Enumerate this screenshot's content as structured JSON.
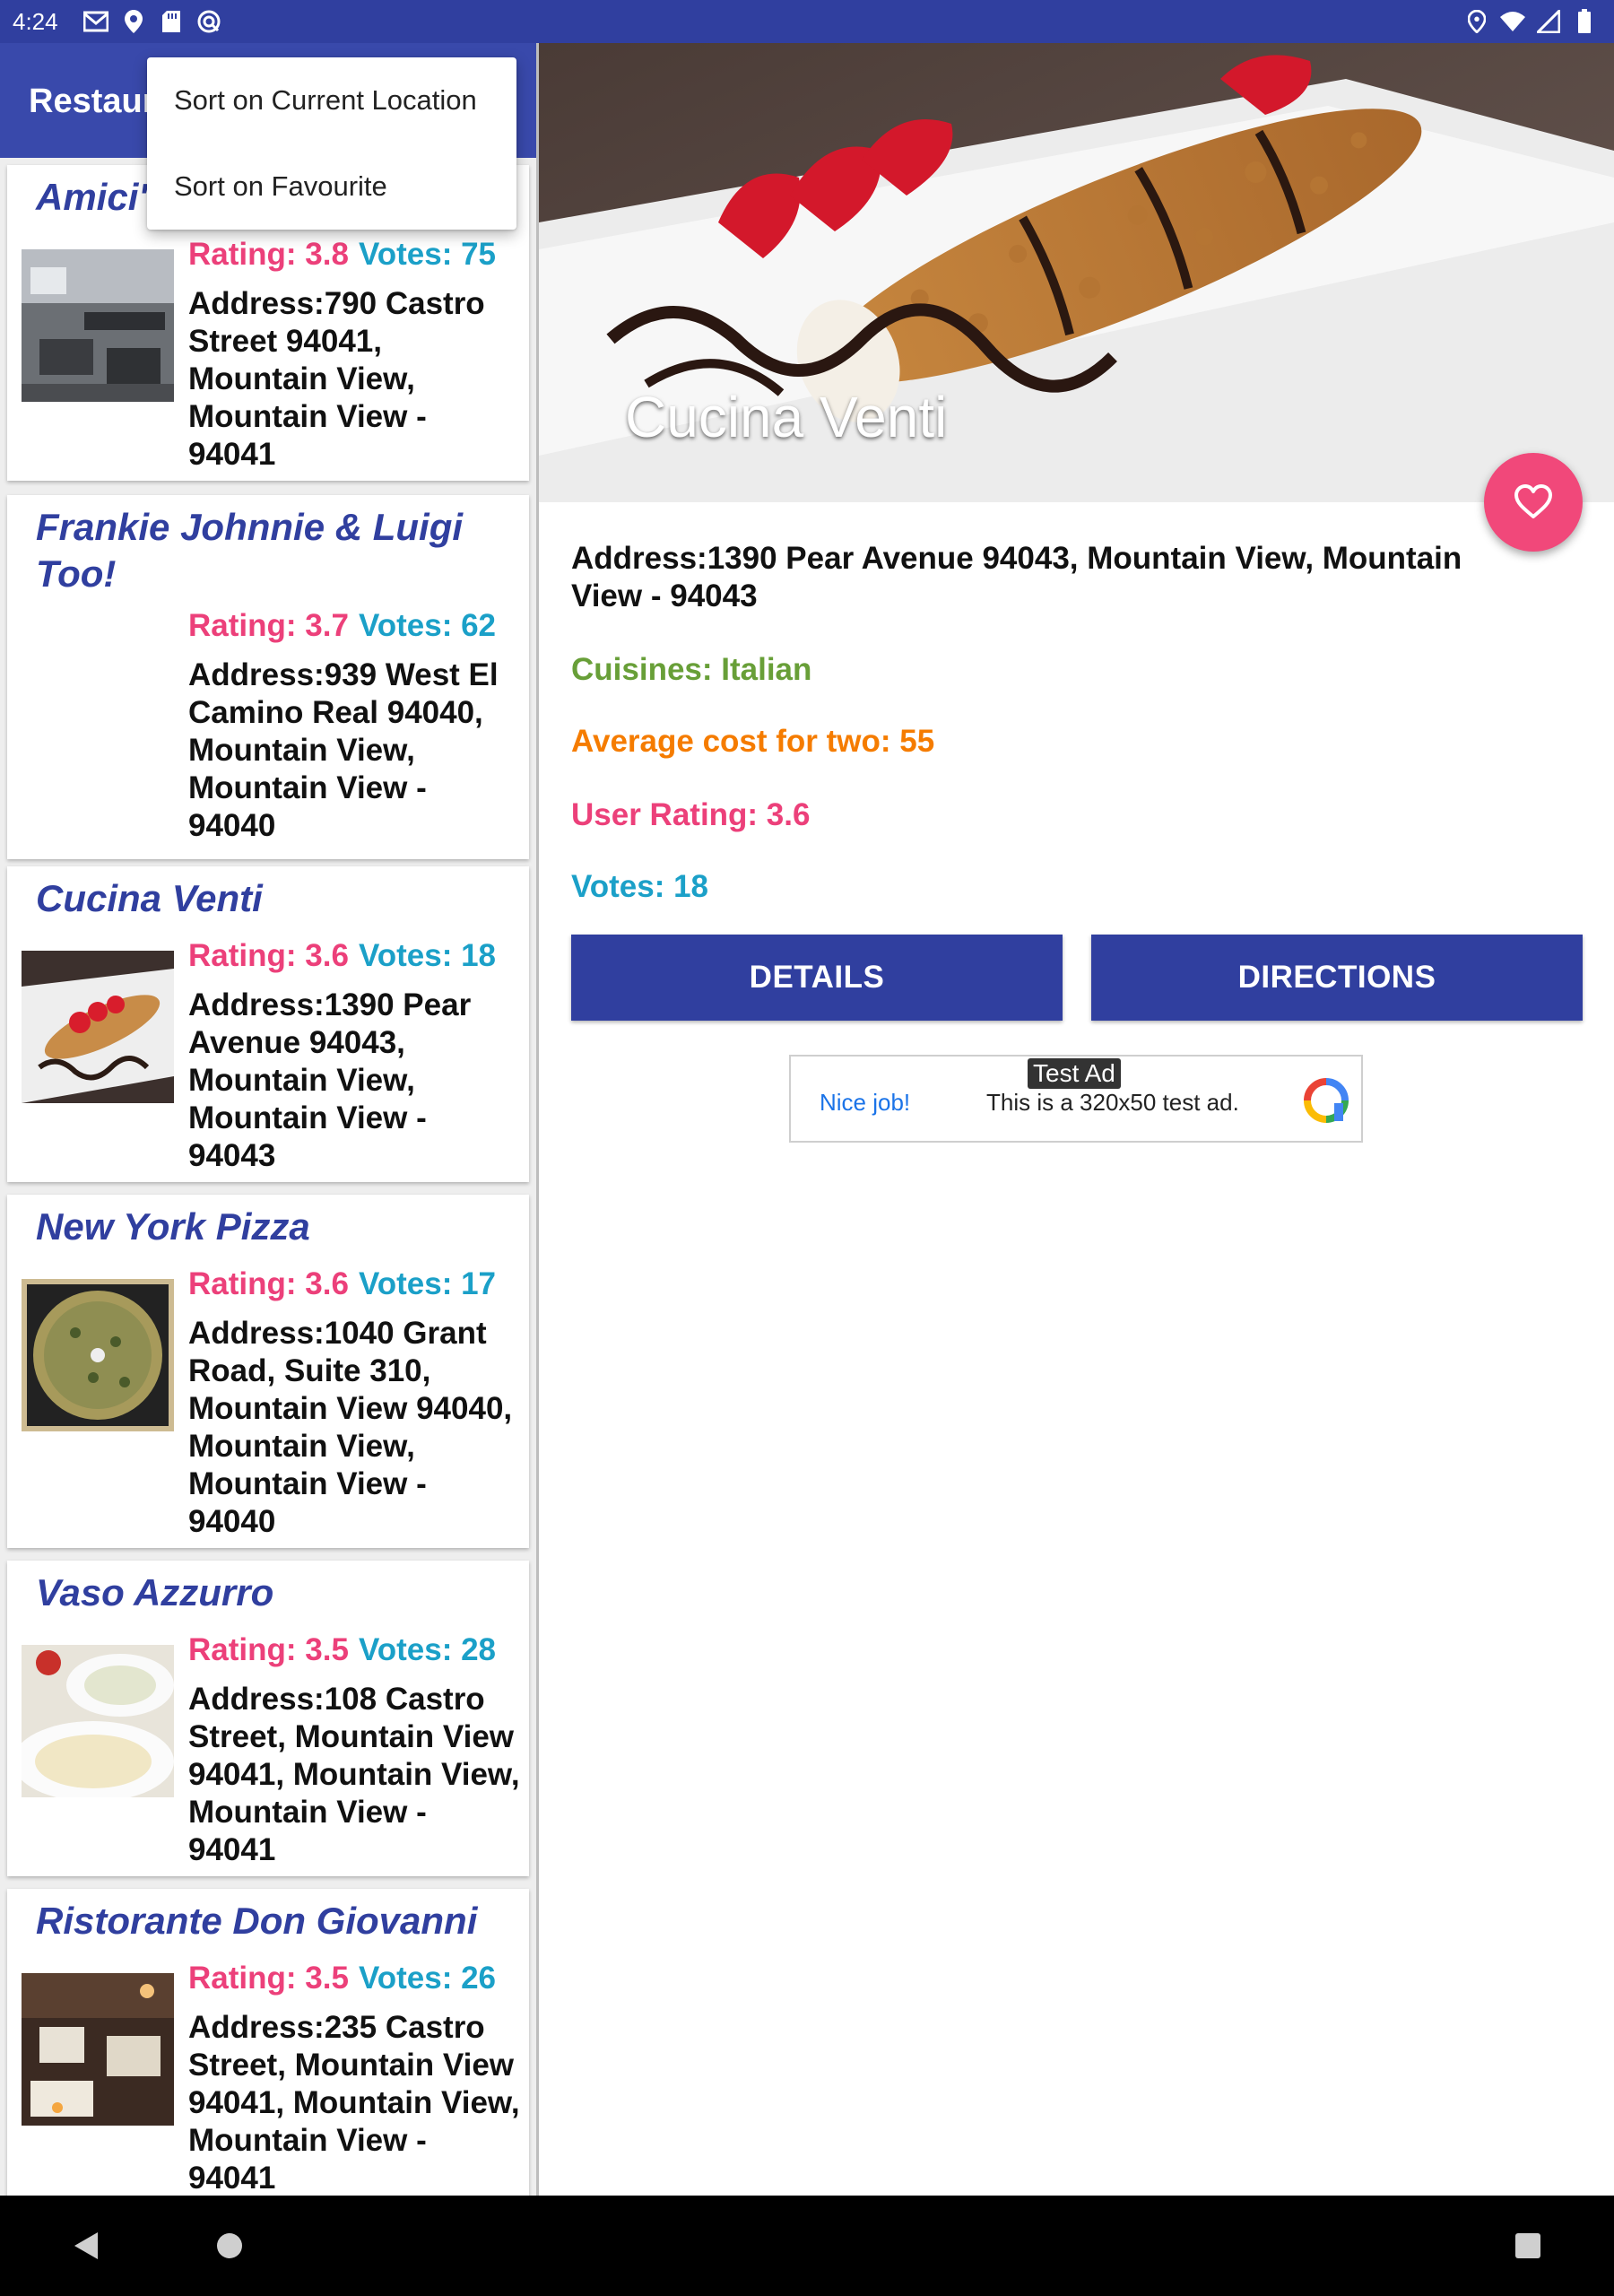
{
  "status_bar": {
    "time": "4:24",
    "left_icons": [
      "gmail-icon",
      "location-icon",
      "sd-card-icon",
      "sync-icon"
    ],
    "right_icons": [
      "location-icon",
      "wifi-icon",
      "signal-icon",
      "battery-icon"
    ]
  },
  "app_bar": {
    "title": "Restaurants"
  },
  "menu": {
    "items": [
      {
        "label": "Sort on Current Location"
      },
      {
        "label": "Sort on Favourite"
      }
    ]
  },
  "restaurants": [
    {
      "name": "Amici's",
      "rating": "Rating: 3.8",
      "votes": "Votes: 75",
      "address": "Address:790 Castro Street 94041, Mountain View, Mountain View - 94041",
      "thumbnail": "restaurant-interior"
    },
    {
      "name": "Frankie Johnnie & Luigi Too!",
      "rating": "Rating: 3.7",
      "votes": "Votes: 62",
      "address": "Address:939 West El Camino Real 94040, Mountain View, Mountain View - 94040",
      "thumbnail": "none"
    },
    {
      "name": "Cucina Venti",
      "rating": "Rating: 3.6",
      "votes": "Votes: 18",
      "address": "Address:1390 Pear Avenue 94043, Mountain View, Mountain View - 94043",
      "thumbnail": "cannoli"
    },
    {
      "name": "New York Pizza",
      "rating": "Rating: 3.6",
      "votes": "Votes: 17",
      "address": "Address:1040 Grant Road, Suite 310, Mountain View 94040, Mountain View, Mountain View - 94040",
      "thumbnail": "pizza"
    },
    {
      "name": "Vaso Azzurro",
      "rating": "Rating: 3.5",
      "votes": "Votes: 28",
      "address": "Address:108 Castro Street, Mountain View 94041, Mountain View, Mountain View - 94041",
      "thumbnail": "plates"
    },
    {
      "name": "Ristorante Don Giovanni",
      "rating": "Rating: 3.5",
      "votes": "Votes: 26",
      "address": "Address:235 Castro Street, Mountain View 94041, Mountain View, Mountain View - 94041",
      "thumbnail": "dining-room"
    }
  ],
  "detail": {
    "name": "Cucina Venti",
    "address": "Address:1390 Pear Avenue 94043, Mountain View, Mountain View - 94043",
    "cuisines": "Cuisines: Italian",
    "average_cost": "Average cost for two: 55",
    "user_rating": "User Rating: 3.6",
    "votes": "Votes: 18",
    "details_button": "DETAILS",
    "directions_button": "DIRECTIONS",
    "favourite_icon": "heart-outline-icon"
  },
  "ad": {
    "badge": "Test Ad",
    "nice": "Nice job!",
    "text": "This is a 320x50 test ad."
  },
  "colors": {
    "primary_dark": "#303f9f",
    "primary": "#3949ab",
    "accent": "#f1487a",
    "rating": "#ec407a",
    "votes": "#1ba0c8",
    "cuisines": "#689f38",
    "cost": "#f57c00"
  }
}
